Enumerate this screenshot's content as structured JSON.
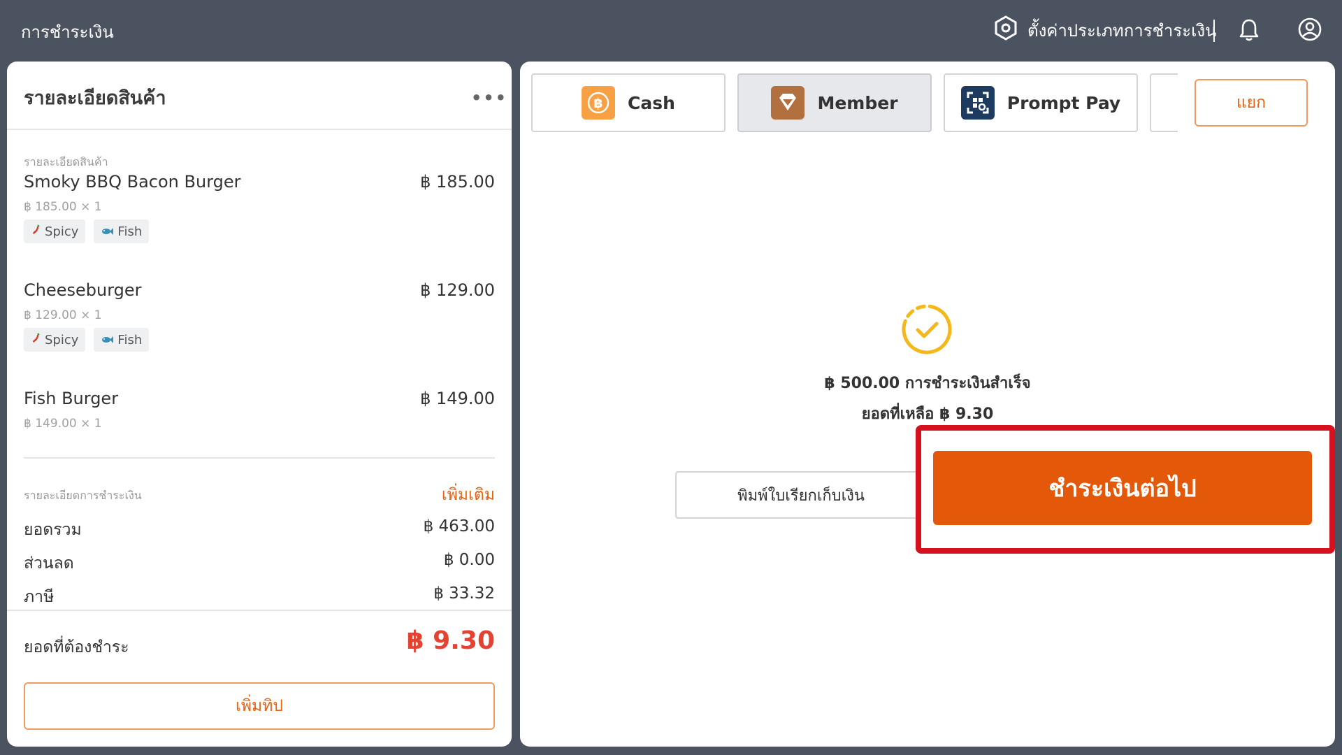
{
  "header": {
    "title": "การชำระเงิน",
    "settings_label": "ตั้งค่าประเภทการชำระเงิน"
  },
  "product_panel": {
    "title": "รายละเอียดสินค้า",
    "section_label": "รายละเอียดสินค้า",
    "items": [
      {
        "name": "Smoky BBQ Bacon Burger",
        "price": "฿ 185.00",
        "sub": "฿ 185.00 × 1",
        "tags": [
          "Spicy",
          "Fish"
        ]
      },
      {
        "name": "Cheeseburger",
        "price": "฿ 129.00",
        "sub": "฿ 129.00 × 1",
        "tags": [
          "Spicy",
          "Fish"
        ]
      },
      {
        "name": "Fish Burger",
        "price": "฿ 149.00",
        "sub": "฿ 149.00 × 1",
        "tags": []
      }
    ],
    "payment_section_label": "รายละเอียดการชำระเงิน",
    "more_label": "เพิ่มเติม",
    "summary": [
      {
        "label": "ยอดรวม",
        "value": "฿ 463.00"
      },
      {
        "label": "ส่วนลด",
        "value": "฿ 0.00"
      },
      {
        "label": "ภาษี",
        "value": "฿ 33.32"
      }
    ],
    "amount_due_label": "ยอดที่ต้องชำระ",
    "amount_due_value": "฿ 9.30",
    "add_tip_label": "เพิ่มทิป"
  },
  "payment_panel": {
    "methods": [
      {
        "label": "Cash",
        "icon": "baht-coin-icon",
        "active": false
      },
      {
        "label": "Member",
        "icon": "member-diamond-icon",
        "active": true
      },
      {
        "label": "Prompt Pay",
        "icon": "qr-scan-icon",
        "active": false
      }
    ],
    "split_label": "แยก",
    "success_text": "฿ 500.00 การชำระเงินสำเร็จ",
    "remaining_text": "ยอดที่เหลือ ฿ 9.30",
    "print_receipt_label": "พิมพ์ใบเรียกเก็บเงิน",
    "continue_label": "ชำระเงินต่อไป"
  },
  "colors": {
    "background": "#4b5260",
    "accent_orange": "#e45909",
    "due_red": "#e64232",
    "highlight_red": "#d6101d",
    "success_yellow": "#f4b81c"
  }
}
